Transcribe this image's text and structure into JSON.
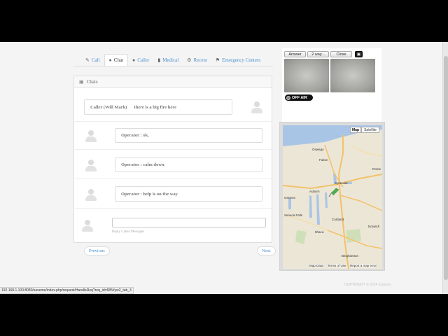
{
  "tabs": [
    {
      "label": "Call",
      "icon": "pencil-icon",
      "glyph": "✎"
    },
    {
      "label": "Chat",
      "icon": "user-icon",
      "glyph": "👤"
    },
    {
      "label": "Caller",
      "icon": "user-icon",
      "glyph": "👤"
    },
    {
      "label": "Medical",
      "icon": "medical-icon",
      "glyph": "▮"
    },
    {
      "label": "Recent",
      "icon": "gear-icon",
      "glyph": "⚙"
    },
    {
      "label": "Emergency Centers",
      "icon": "flag-icon",
      "glyph": "⚑"
    }
  ],
  "active_tab": "Chat",
  "chat": {
    "title": "Chats",
    "messages": [
      {
        "sender": "Caller (Will Mark)",
        "text": "there is a big fire here"
      },
      {
        "sender": "Operator",
        "text": "ok."
      },
      {
        "sender": "Operator",
        "text": "calm down"
      },
      {
        "sender": "Operator",
        "text": "help is on the way"
      }
    ],
    "reply_value": "",
    "reply_hint": "Reply Caller Messages"
  },
  "pager": {
    "previous": "Previous",
    "next": "Next"
  },
  "video": {
    "buttons": {
      "answer": "Answer",
      "two_way": "2 way...",
      "close": "Close"
    },
    "status": "OFF AIR"
  },
  "map": {
    "types": {
      "map": "Map",
      "satellite": "Satellite"
    },
    "cities": [
      "Oswego",
      "Fulton",
      "Syracuse",
      "Auburn",
      "Geneva",
      "Seneca Falls",
      "Cortland",
      "Ithaca",
      "Norwich",
      "Binghamton",
      "Rome"
    ],
    "footer": {
      "map_data": "Map Data",
      "terms": "Terms of Use",
      "report": "Report a map error"
    }
  },
  "copyright": "COPYRIGHT © 2014 xxxxxxx",
  "status_url": "192.168.1.100:8080/saveme/index.php/request/HandleReq?req_id=685#yw2_tab_3"
}
